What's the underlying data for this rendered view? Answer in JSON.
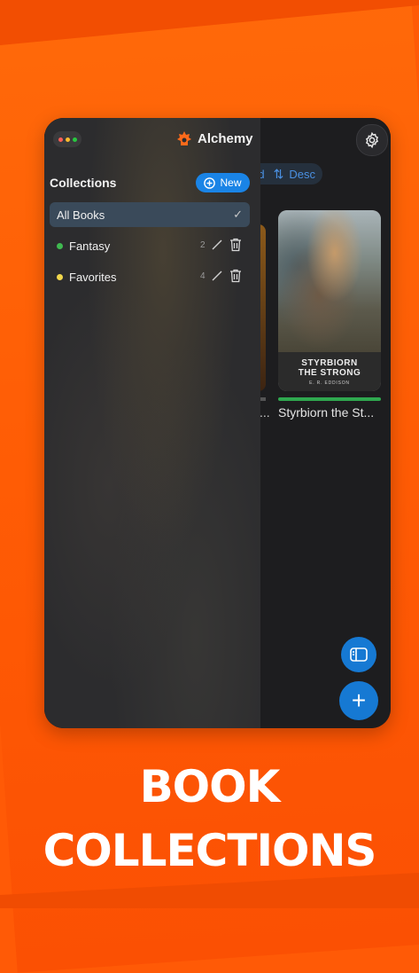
{
  "header": {
    "app_name": "Alchemy",
    "settings_icon": "gear-icon"
  },
  "sort": {
    "partial_label": "d",
    "direction_label": "Desc"
  },
  "collections": {
    "title": "Collections",
    "new_button_label": "New",
    "items": [
      {
        "label": "All Books",
        "selected": true
      },
      {
        "label": "Fantasy",
        "count": "2",
        "color": "#3fb950"
      },
      {
        "label": "Favorites",
        "count": "4",
        "color": "#f1d74c"
      }
    ]
  },
  "library": {
    "partial_book_label": "...",
    "books": [
      {
        "title_line1": "STYRBIORN",
        "title_line2": "THE STRONG",
        "author": "E. R. EDDISON",
        "display_title": "Styrbiorn the St...",
        "progress": 1.0
      }
    ]
  },
  "fab": {
    "add_label": "+"
  },
  "headline": {
    "line1": "BOOK",
    "line2": "COLLECTIONS"
  },
  "colors": {
    "accent": "#1679d3",
    "background": "#ff5a06",
    "progress": "#2fa84f"
  }
}
